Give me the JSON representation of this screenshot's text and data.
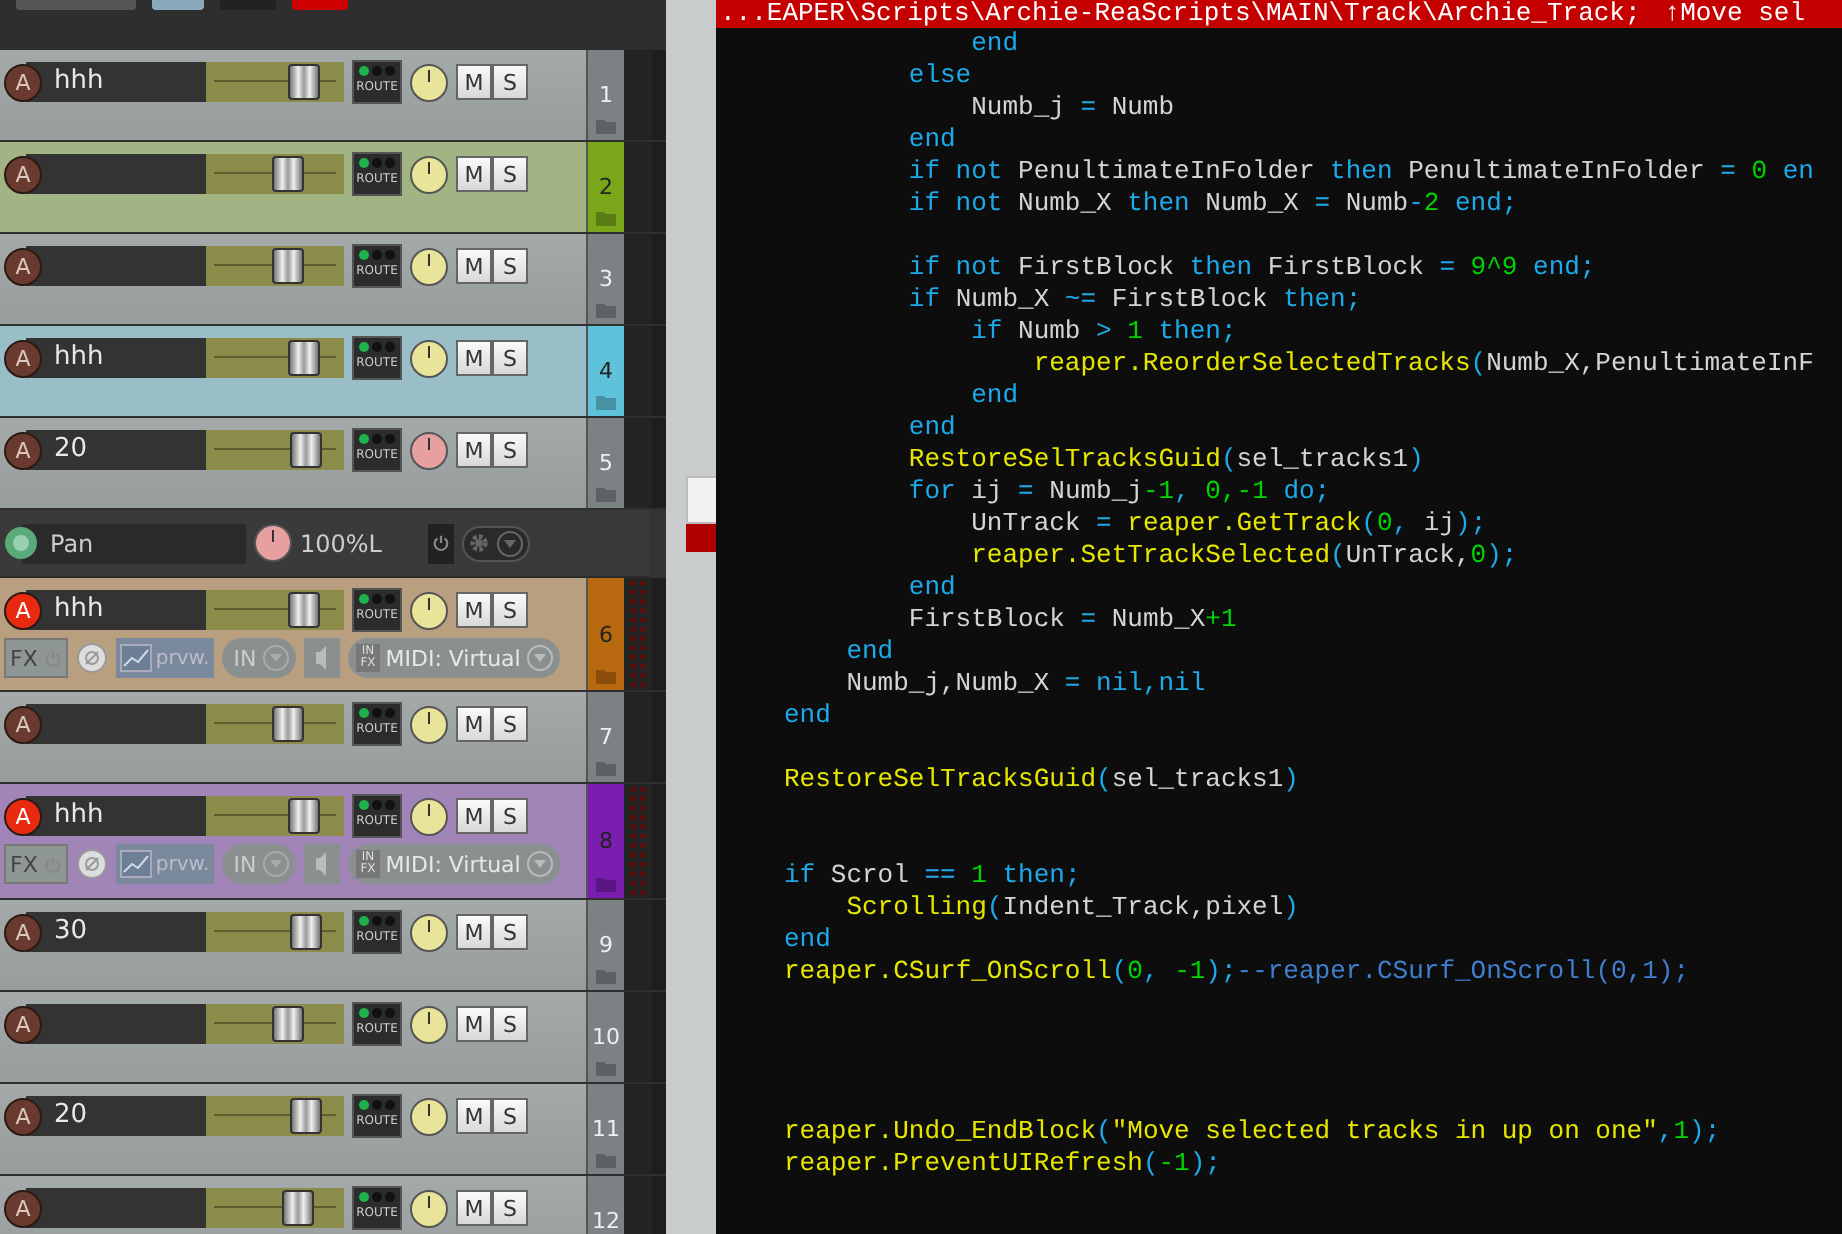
{
  "tracks": [
    {
      "name": "hhh",
      "number": "1",
      "armed": false,
      "level": 0.71,
      "pan_automated": false,
      "expanded": false,
      "labels": {
        "arm": "A",
        "route": "ROUTE",
        "mute": "M",
        "solo": "S"
      }
    },
    {
      "number": "2",
      "color": "#7aa61a",
      "armed": false,
      "level": 0.6,
      "pan_automated": false,
      "expanded": false,
      "labels": {
        "arm": "A",
        "route": "ROUTE",
        "mute": "M",
        "solo": "S"
      }
    },
    {
      "number": "3",
      "armed": false,
      "level": 0.6,
      "pan_automated": false,
      "expanded": false,
      "labels": {
        "arm": "A",
        "route": "ROUTE",
        "mute": "M",
        "solo": "S"
      }
    },
    {
      "name": "hhh",
      "number": "4",
      "color": "#5ec3da",
      "armed": false,
      "level": 0.71,
      "pan_automated": false,
      "expanded": false,
      "labels": {
        "arm": "A",
        "route": "ROUTE",
        "mute": "M",
        "solo": "S"
      }
    },
    {
      "name": "20",
      "number": "5",
      "armed": false,
      "level": 0.73,
      "pan_automated": true,
      "expanded": false,
      "labels": {
        "arm": "A",
        "route": "ROUTE",
        "mute": "M",
        "solo": "S"
      },
      "envelope": {
        "name": "Pan",
        "reading": "100%L"
      }
    },
    {
      "name": "hhh",
      "number": "6",
      "color": "#b8680e",
      "armed": true,
      "level": 0.71,
      "pan_automated": false,
      "expanded": true,
      "labels": {
        "arm": "A",
        "route": "ROUTE",
        "mute": "M",
        "solo": "S"
      },
      "fx_row": {
        "fx": "FX",
        "preview": "prvw.",
        "input": "IN",
        "input_fx": [
          "IN",
          "FX"
        ],
        "midi": "MIDI: Virtual"
      }
    },
    {
      "number": "7",
      "armed": false,
      "level": 0.6,
      "pan_automated": false,
      "expanded": false,
      "labels": {
        "arm": "A",
        "route": "ROUTE",
        "mute": "M",
        "solo": "S"
      }
    },
    {
      "name": "hhh",
      "number": "8",
      "color": "#7a1eb0",
      "armed": true,
      "level": 0.71,
      "pan_automated": false,
      "expanded": true,
      "labels": {
        "arm": "A",
        "route": "ROUTE",
        "mute": "M",
        "solo": "S"
      },
      "fx_row": {
        "fx": "FX",
        "preview": "prvw.",
        "input": "IN",
        "input_fx": [
          "IN",
          "FX"
        ],
        "midi": "MIDI: Virtual"
      }
    },
    {
      "name": "30",
      "number": "9",
      "armed": false,
      "level": 0.73,
      "pan_automated": false,
      "expanded": false,
      "labels": {
        "arm": "A",
        "route": "ROUTE",
        "mute": "M",
        "solo": "S"
      }
    },
    {
      "number": "10",
      "armed": false,
      "level": 0.6,
      "pan_automated": false,
      "expanded": false,
      "labels": {
        "arm": "A",
        "route": "ROUTE",
        "mute": "M",
        "solo": "S"
      }
    },
    {
      "name": "20",
      "number": "11",
      "armed": false,
      "level": 0.73,
      "pan_automated": false,
      "expanded": false,
      "labels": {
        "arm": "A",
        "route": "ROUTE",
        "mute": "M",
        "solo": "S"
      }
    },
    {
      "number": "12",
      "armed": false,
      "level": 0.67,
      "pan_automated": false,
      "expanded": false,
      "labels": {
        "arm": "A",
        "route": "ROUTE",
        "mute": "M",
        "solo": "S"
      }
    }
  ],
  "editor": {
    "title": "...EAPER\\Scripts\\Archie-ReaScripts\\MAIN\\Track\\Archie_Track;",
    "title_extra": "↑Move sel",
    "lines": [
      {
        "kind": "block",
        "children": [
          {
            "kind": "block",
            "children": [
              {
                "kind": "block",
                "children": [
                  {
                    "kind": "code",
                    "tokens": [
                      {
                        "kind": "keyword",
                        "text": "end"
                      }
                    ]
                  }
                ]
              },
              {
                "kind": "code",
                "tokens": [
                  {
                    "kind": "keyword",
                    "text": "else"
                  }
                ],
                "children": [
                  {
                    "kind": "code",
                    "tokens": [
                      {
                        "kind": "ident",
                        "text": "Numb_j "
                      },
                      {
                        "kind": "op",
                        "text": "= "
                      },
                      {
                        "kind": "ident",
                        "text": "Numb"
                      }
                    ]
                  }
                ]
              },
              {
                "kind": "code",
                "tokens": [
                  {
                    "kind": "keyword",
                    "text": "end"
                  }
                ]
              },
              {
                "kind": "code",
                "tokens": [
                  {
                    "kind": "keyword",
                    "text": "if not "
                  },
                  {
                    "kind": "ident",
                    "text": "PenultimateInFolder "
                  },
                  {
                    "kind": "keyword",
                    "text": "then "
                  },
                  {
                    "kind": "ident",
                    "text": "PenultimateInFolder "
                  },
                  {
                    "kind": "op",
                    "text": "= "
                  },
                  {
                    "kind": "number",
                    "text": "0 "
                  },
                  {
                    "kind": "keyword",
                    "text": "en"
                  }
                ]
              },
              {
                "kind": "code",
                "tokens": [
                  {
                    "kind": "keyword",
                    "text": "if not "
                  },
                  {
                    "kind": "ident",
                    "text": "Numb_X "
                  },
                  {
                    "kind": "keyword",
                    "text": "then "
                  },
                  {
                    "kind": "ident",
                    "text": "Numb_X "
                  },
                  {
                    "kind": "op",
                    "text": "= "
                  },
                  {
                    "kind": "ident",
                    "text": "Numb"
                  },
                  {
                    "kind": "op",
                    "text": "-"
                  },
                  {
                    "kind": "number",
                    "text": "2 "
                  },
                  {
                    "kind": "keyword",
                    "text": "end;"
                  }
                ]
              },
              {
                "kind": "blank"
              },
              {
                "kind": "code",
                "tokens": [
                  {
                    "kind": "keyword",
                    "text": "if not "
                  },
                  {
                    "kind": "ident",
                    "text": "FirstBlock "
                  },
                  {
                    "kind": "keyword",
                    "text": "then "
                  },
                  {
                    "kind": "ident",
                    "text": "FirstBlock "
                  },
                  {
                    "kind": "op",
                    "text": "= "
                  },
                  {
                    "kind": "number",
                    "text": "9^9 "
                  },
                  {
                    "kind": "keyword",
                    "text": "end;"
                  }
                ]
              },
              {
                "kind": "code",
                "tokens": [
                  {
                    "kind": "keyword",
                    "text": "if "
                  },
                  {
                    "kind": "ident",
                    "text": "Numb_X "
                  },
                  {
                    "kind": "op",
                    "text": "~= "
                  },
                  {
                    "kind": "ident",
                    "text": "FirstBlock "
                  },
                  {
                    "kind": "keyword",
                    "text": "then;"
                  }
                ],
                "children": [
                  {
                    "kind": "code",
                    "tokens": [
                      {
                        "kind": "keyword",
                        "text": "if "
                      },
                      {
                        "kind": "ident",
                        "text": "Numb "
                      },
                      {
                        "kind": "op",
                        "text": "> "
                      },
                      {
                        "kind": "number",
                        "text": "1 "
                      },
                      {
                        "kind": "keyword",
                        "text": "then;"
                      }
                    ],
                    "children": [
                      {
                        "kind": "code",
                        "tokens": [
                          {
                            "kind": "func",
                            "text": "reaper.ReorderSelectedTracks"
                          },
                          {
                            "kind": "op",
                            "text": "("
                          },
                          {
                            "kind": "ident",
                            "text": "Numb_X,PenultimateInF"
                          }
                        ]
                      }
                    ]
                  },
                  {
                    "kind": "code",
                    "tokens": [
                      {
                        "kind": "keyword",
                        "text": "end"
                      }
                    ]
                  }
                ]
              },
              {
                "kind": "code",
                "tokens": [
                  {
                    "kind": "keyword",
                    "text": "end"
                  }
                ]
              },
              {
                "kind": "code",
                "tokens": [
                  {
                    "kind": "func",
                    "text": "RestoreSelTracksGuid"
                  },
                  {
                    "kind": "op",
                    "text": "("
                  },
                  {
                    "kind": "ident",
                    "text": "sel_tracks1"
                  },
                  {
                    "kind": "op",
                    "text": ")"
                  }
                ]
              },
              {
                "kind": "code",
                "tokens": [
                  {
                    "kind": "keyword",
                    "text": "for "
                  },
                  {
                    "kind": "ident",
                    "text": "ij "
                  },
                  {
                    "kind": "op",
                    "text": "= "
                  },
                  {
                    "kind": "ident",
                    "text": "Numb_j"
                  },
                  {
                    "kind": "number",
                    "text": "-1"
                  },
                  {
                    "kind": "op",
                    "text": ", "
                  },
                  {
                    "kind": "number",
                    "text": "0,-1 "
                  },
                  {
                    "kind": "keyword",
                    "text": "do;"
                  }
                ],
                "children": [
                  {
                    "kind": "code",
                    "tokens": [
                      {
                        "kind": "ident",
                        "text": "UnTrack "
                      },
                      {
                        "kind": "op",
                        "text": "= "
                      },
                      {
                        "kind": "func",
                        "text": "reaper.GetTrack"
                      },
                      {
                        "kind": "op",
                        "text": "("
                      },
                      {
                        "kind": "number",
                        "text": "0"
                      },
                      {
                        "kind": "op",
                        "text": ", "
                      },
                      {
                        "kind": "ident",
                        "text": "ij"
                      },
                      {
                        "kind": "op",
                        "text": ");"
                      }
                    ]
                  },
                  {
                    "kind": "code",
                    "tokens": [
                      {
                        "kind": "func",
                        "text": "reaper.SetTrackSelected"
                      },
                      {
                        "kind": "op",
                        "text": "("
                      },
                      {
                        "kind": "ident",
                        "text": "UnTrack,"
                      },
                      {
                        "kind": "number",
                        "text": "0"
                      },
                      {
                        "kind": "op",
                        "text": ");"
                      }
                    ]
                  }
                ]
              },
              {
                "kind": "code",
                "tokens": [
                  {
                    "kind": "keyword",
                    "text": "end"
                  }
                ]
              },
              {
                "kind": "code",
                "tokens": [
                  {
                    "kind": "ident",
                    "text": "FirstBlock "
                  },
                  {
                    "kind": "op",
                    "text": "= "
                  },
                  {
                    "kind": "ident",
                    "text": "Numb_X"
                  },
                  {
                    "kind": "number",
                    "text": "+1"
                  }
                ]
              }
            ]
          },
          {
            "kind": "code",
            "tokens": [
              {
                "kind": "keyword",
                "text": "end"
              }
            ]
          },
          {
            "kind": "code",
            "tokens": [
              {
                "kind": "ident",
                "text": "Numb_j,Numb_X "
              },
              {
                "kind": "op",
                "text": "= "
              },
              {
                "kind": "keyword",
                "text": "nil,nil"
              }
            ]
          }
        ]
      },
      {
        "kind": "code",
        "tokens": [
          {
            "kind": "keyword",
            "text": "end"
          }
        ]
      },
      {
        "kind": "blank"
      },
      {
        "kind": "code",
        "tokens": [
          {
            "kind": "func",
            "text": "RestoreSelTracksGuid"
          },
          {
            "kind": "op",
            "text": "("
          },
          {
            "kind": "ident",
            "text": "sel_tracks1"
          },
          {
            "kind": "op",
            "text": ")"
          }
        ]
      },
      {
        "kind": "blank"
      },
      {
        "kind": "blank"
      },
      {
        "kind": "code",
        "tokens": [
          {
            "kind": "keyword",
            "text": "if "
          },
          {
            "kind": "ident",
            "text": "Scrol "
          },
          {
            "kind": "op",
            "text": "== "
          },
          {
            "kind": "number",
            "text": "1 "
          },
          {
            "kind": "keyword",
            "text": "then;"
          }
        ],
        "children": [
          {
            "kind": "code",
            "tokens": [
              {
                "kind": "func",
                "text": "Scrolling"
              },
              {
                "kind": "op",
                "text": "("
              },
              {
                "kind": "ident",
                "text": "Indent_Track,pixel"
              },
              {
                "kind": "op",
                "text": ")"
              }
            ]
          }
        ]
      },
      {
        "kind": "code",
        "tokens": [
          {
            "kind": "keyword",
            "text": "end"
          }
        ]
      },
      {
        "kind": "code",
        "tokens": [
          {
            "kind": "func",
            "text": "reaper.CSurf_OnScroll"
          },
          {
            "kind": "op",
            "text": "("
          },
          {
            "kind": "number",
            "text": "0"
          },
          {
            "kind": "op",
            "text": ", "
          },
          {
            "kind": "number",
            "text": "-1"
          },
          {
            "kind": "op",
            "text": ");"
          },
          {
            "kind": "comment",
            "text": "--reaper.CSurf_OnScroll(0,1);"
          }
        ]
      },
      {
        "kind": "blank"
      },
      {
        "kind": "blank"
      },
      {
        "kind": "blank"
      },
      {
        "kind": "blank"
      },
      {
        "kind": "code",
        "tokens": [
          {
            "kind": "func",
            "text": "reaper.Undo_EndBlock"
          },
          {
            "kind": "op",
            "text": "("
          },
          {
            "kind": "string",
            "text": "\"Move selected tracks in up on one\""
          },
          {
            "kind": "op",
            "text": ","
          },
          {
            "kind": "number",
            "text": "1"
          },
          {
            "kind": "op",
            "text": ");"
          }
        ]
      },
      {
        "kind": "code",
        "tokens": [
          {
            "kind": "func",
            "text": "reaper.PreventUIRefresh"
          },
          {
            "kind": "op",
            "text": "("
          },
          {
            "kind": "number",
            "text": "-1"
          },
          {
            "kind": "op",
            "text": ");"
          }
        ]
      }
    ]
  }
}
